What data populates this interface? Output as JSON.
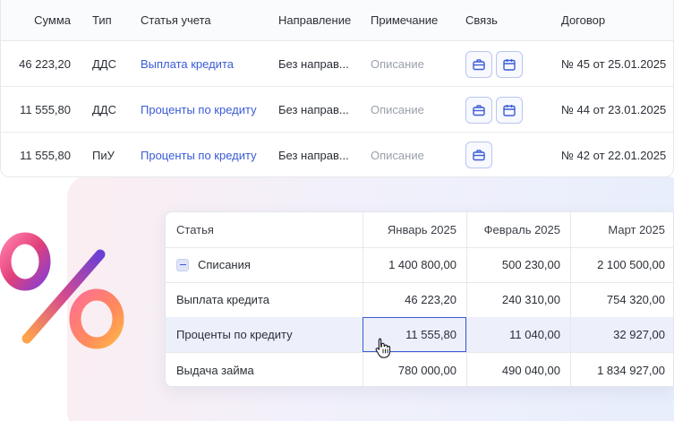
{
  "top_table": {
    "headers": {
      "sum": "Сумма",
      "type": "Тип",
      "article": "Статья учета",
      "direction": "Направление",
      "note": "Примечание",
      "link": "Связь",
      "contract": "Договор"
    },
    "rows": [
      {
        "sum": "46 223,20",
        "type": "ДДС",
        "article": "Выплата кредита",
        "direction": "Без направ...",
        "note": "Описание",
        "contract": "№ 45 от 25.01.2025"
      },
      {
        "sum": "11 555,80",
        "type": "ДДС",
        "article": "Проценты по кредиту",
        "direction": "Без направ...",
        "note": "Описание",
        "contract": "№ 44 от 23.01.2025"
      },
      {
        "sum": "11 555,80",
        "type": "ПиУ",
        "article": "Проценты по кредиту",
        "direction": "Без направ...",
        "note": "Описание",
        "contract": "№ 42 от 22.01.2025"
      }
    ]
  },
  "bottom_table": {
    "headers": {
      "label": "Статья",
      "jan": "Январь 2025",
      "feb": "Февраль 2025",
      "mar": "Март 2025"
    },
    "rows": [
      {
        "label": "Списания",
        "jan": "1 400 800,00",
        "feb": "500 230,00",
        "mar": "2 100 500,00"
      },
      {
        "label": "Выплата кредита",
        "jan": "46 223,20",
        "feb": "240 310,00",
        "mar": "754 320,00"
      },
      {
        "label": "Проценты по кредиту",
        "jan": "11 555,80",
        "feb": "11 040,00",
        "mar": "32 927,00"
      },
      {
        "label": "Выдача займа",
        "jan": "780 000,00",
        "feb": "490 040,00",
        "mar": "1 834 927,00"
      }
    ]
  },
  "icons": {
    "link_a": "briefcase-icon",
    "link_b": "calendar-icon",
    "decor": "percent-icon",
    "cursor": "hand-cursor-icon"
  },
  "colors": {
    "accent": "#3a5bd6",
    "muted": "#9aa0aa",
    "highlight": "#edf0fb"
  }
}
